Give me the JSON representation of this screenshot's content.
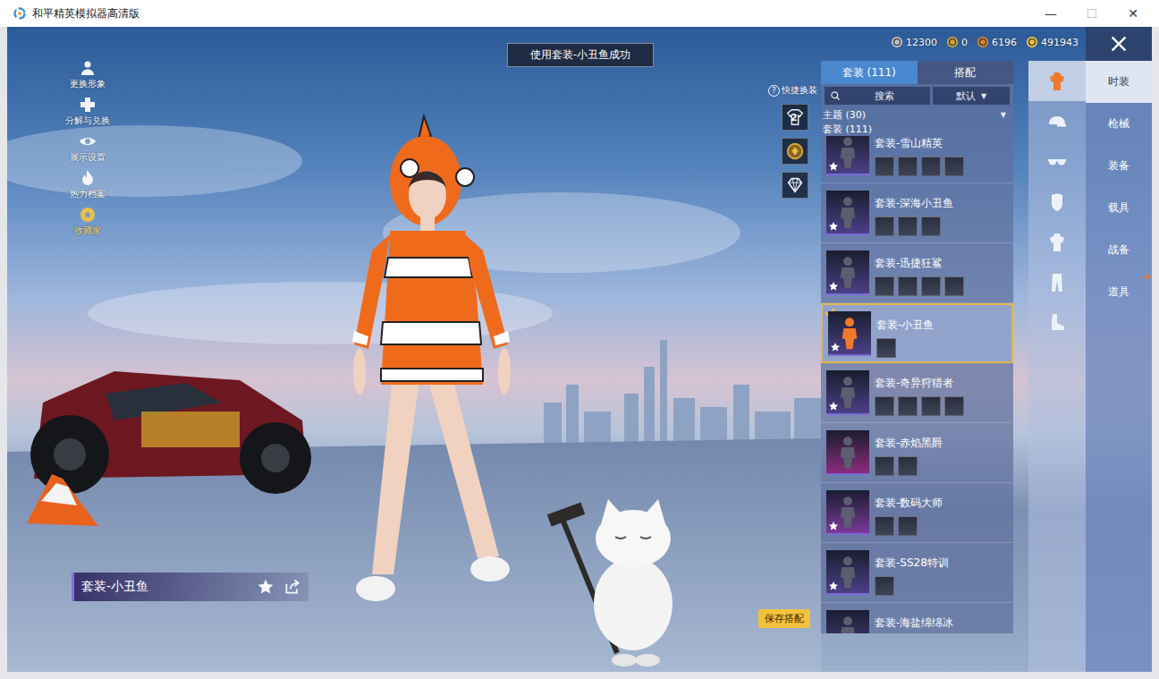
{
  "window": {
    "title": "和平精英模拟器高清版",
    "controls": [
      {
        "glyph": "—",
        "disabled": false
      },
      {
        "glyph": "☐",
        "disabled": true
      },
      {
        "glyph": "✕",
        "disabled": false
      }
    ]
  },
  "toast": "使用套装-小丑鱼成功",
  "currencies": [
    {
      "amount": "12300",
      "color": "#b8bcc8"
    },
    {
      "amount": "0",
      "color": "#c9a24a"
    },
    {
      "amount": "6196",
      "color": "#d0863a"
    },
    {
      "amount": "491943",
      "color": "#e8c04a"
    }
  ],
  "side_menu": [
    {
      "label": "更换形象",
      "highlighted": false
    },
    {
      "label": "分解与兑换",
      "highlighted": false
    },
    {
      "label": "展示设置",
      "highlighted": false
    },
    {
      "label": "热力档案",
      "highlighted": false
    },
    {
      "label": "收藏家",
      "highlighted": true
    }
  ],
  "quick_change": {
    "help": "?",
    "label": "快捷换装",
    "slots": [
      {
        "kind": "outfit",
        "badge": "2"
      },
      {
        "kind": "emblem",
        "badge": ""
      },
      {
        "kind": "diamond",
        "badge": ""
      }
    ]
  },
  "current_outfit": {
    "name": "套装-小丑鱼"
  },
  "save_button": "保存搭配",
  "panel": {
    "tabs": [
      {
        "label": "套装 (111)",
        "selected": true
      },
      {
        "label": "搭配",
        "selected": false
      }
    ],
    "search": {
      "placeholder": "搜索"
    },
    "sort": {
      "value": "默认",
      "arrow": "▼"
    },
    "theme_filter": {
      "label": "主题 (30)",
      "arrow": "▼"
    },
    "section_header": "套装 (111)",
    "outfits": [
      {
        "name": "套装-雪山精英",
        "pieces": 4,
        "favorite": true,
        "selected": false,
        "color": "#4b3f86"
      },
      {
        "name": "套装-深海小丑鱼",
        "pieces": 3,
        "favorite": true,
        "selected": false,
        "color": "#4b3f86"
      },
      {
        "name": "套装-迅捷狂鲨",
        "pieces": 4,
        "favorite": true,
        "selected": false,
        "color": "#4b3f86"
      },
      {
        "name": "套装-小丑鱼",
        "pieces": 1,
        "favorite": true,
        "selected": true,
        "color": "#4b3f86"
      },
      {
        "name": "套装-奇异狩猎者",
        "pieces": 4,
        "favorite": true,
        "selected": false,
        "color": "#4b3f86"
      },
      {
        "name": "套装-赤焰黑爵",
        "pieces": 2,
        "favorite": false,
        "selected": false,
        "color": "#8b2c7e"
      },
      {
        "name": "套装-数码大师",
        "pieces": 2,
        "favorite": true,
        "selected": false,
        "color": "#7a3a9a"
      },
      {
        "name": "套装-SS28特训",
        "pieces": 1,
        "favorite": true,
        "selected": false,
        "color": "#4b3f86"
      },
      {
        "name": "套装-海盐绵绵冰",
        "pieces": 0,
        "favorite": true,
        "selected": false,
        "color": "#4b3f86"
      }
    ]
  },
  "categories": [
    {
      "kind": "suit",
      "selected": true
    },
    {
      "kind": "hat",
      "selected": false
    },
    {
      "kind": "glasses",
      "selected": false
    },
    {
      "kind": "mask",
      "selected": false
    },
    {
      "kind": "top",
      "selected": false
    },
    {
      "kind": "pants",
      "selected": false
    },
    {
      "kind": "shoes",
      "selected": false
    }
  ],
  "main_tabs": [
    {
      "label": "时装",
      "selected": true,
      "notice": false
    },
    {
      "label": "枪械",
      "selected": false,
      "notice": false
    },
    {
      "label": "装备",
      "selected": false,
      "notice": false
    },
    {
      "label": "载具",
      "selected": false,
      "notice": false
    },
    {
      "label": "战备",
      "selected": false,
      "notice": false
    },
    {
      "label": "道具",
      "selected": false,
      "notice": true
    }
  ]
}
